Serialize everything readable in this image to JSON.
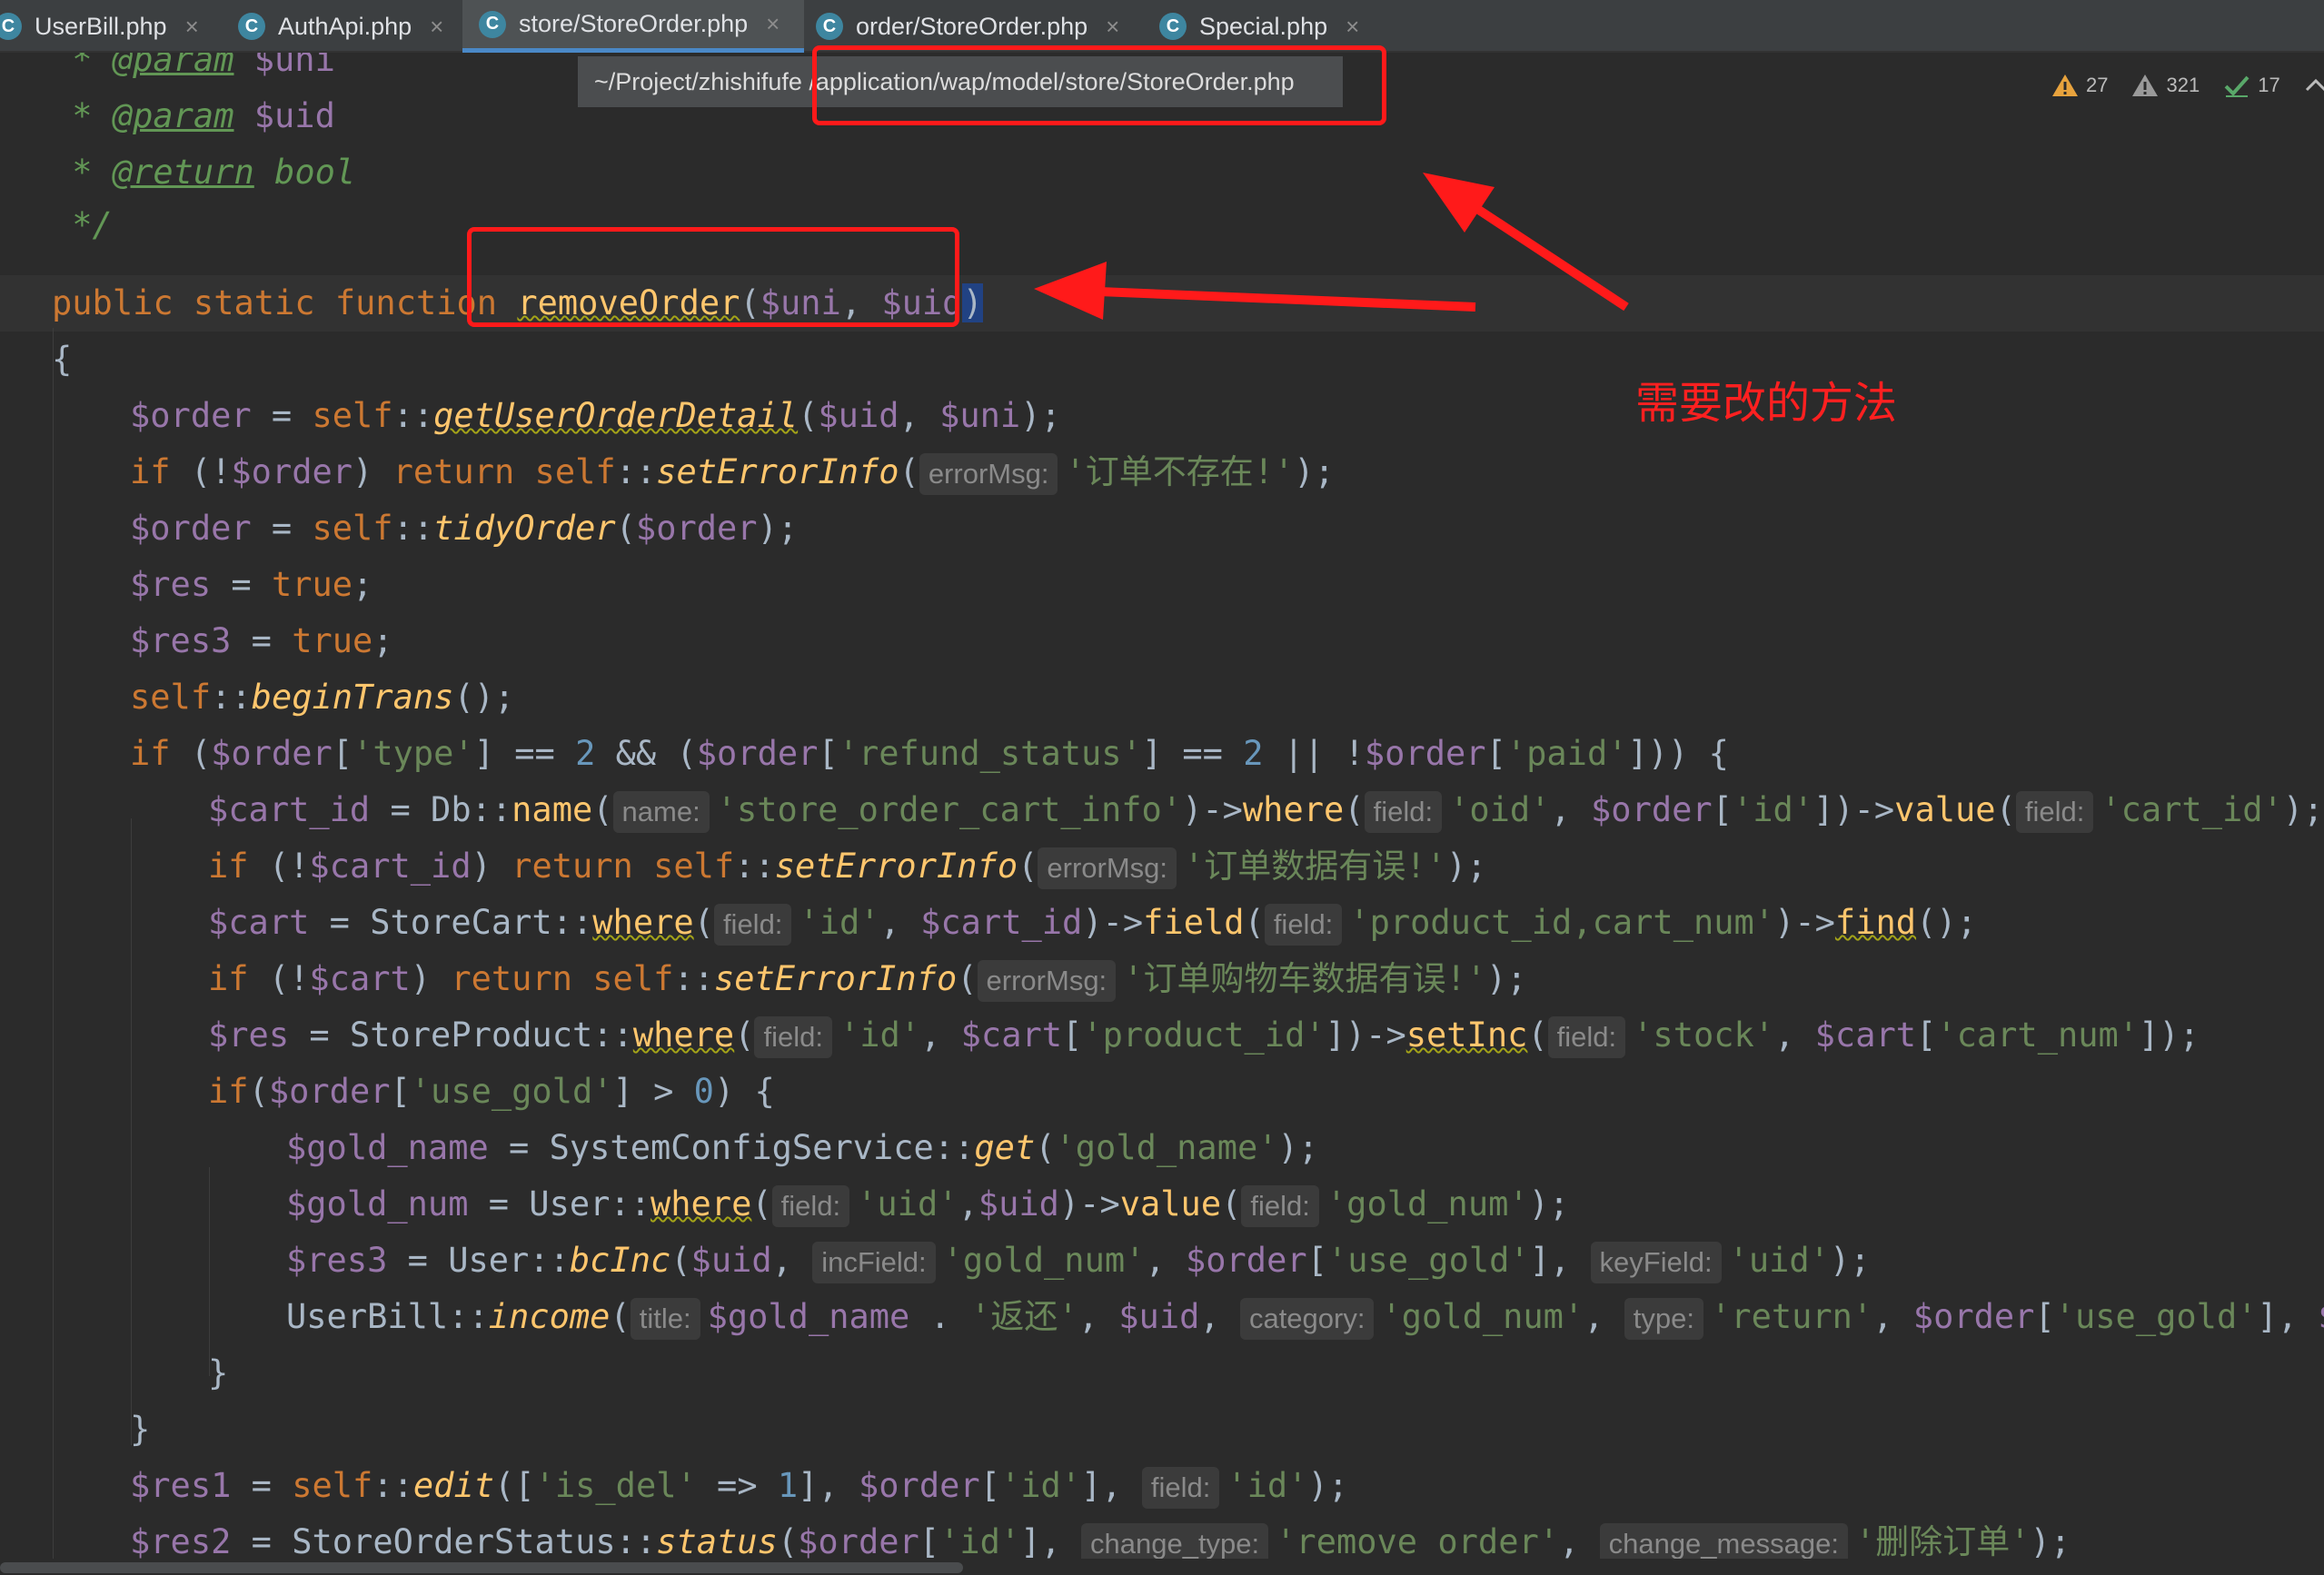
{
  "tabs": [
    {
      "label": "UserBill.php",
      "icon": "class-icon",
      "active": false
    },
    {
      "label": "AuthApi.php",
      "icon": "class-icon",
      "active": false
    },
    {
      "label": "store/StoreOrder.php",
      "icon": "class-icon",
      "active": true
    },
    {
      "label": "order/StoreOrder.php",
      "icon": "class-icon",
      "active": false
    },
    {
      "label": "Special.php",
      "icon": "class-icon",
      "active": false
    }
  ],
  "tab_icon_letter": "C",
  "tab_close_glyph": "×",
  "path_tooltip": "~/Project/zhishifufe /application/wap/model/store/StoreOrder.php",
  "inspections": {
    "warnings": "27",
    "weak_warnings": "321",
    "typos": "17"
  },
  "annotation_note": "需要改的方法",
  "colors": {
    "annotation": "#ff1a1a",
    "keyword": "#cc7832",
    "variable": "#9876aa",
    "string": "#6a8759",
    "number": "#6897bb",
    "function": "#ffc66d",
    "doc_comment": "#629755"
  },
  "code": {
    "l0": [
      [
        "com",
        " * "
      ],
      [
        "tag",
        "@param"
      ],
      [
        "var",
        " $uni"
      ]
    ],
    "l1": [
      [
        "com",
        " * "
      ],
      [
        "tag",
        "@param"
      ],
      [
        "var",
        " $uid"
      ]
    ],
    "l2": [
      [
        "com",
        " * "
      ],
      [
        "tag",
        "@return"
      ],
      [
        "com",
        " bool"
      ]
    ],
    "l3": [
      [
        "com",
        " */"
      ]
    ],
    "l4": [
      [
        "kw",
        "public static function "
      ],
      [
        "fnw",
        "removeOrder"
      ],
      [
        "p",
        "("
      ],
      [
        "var",
        "$uni"
      ],
      [
        "p",
        ", "
      ],
      [
        "var",
        "$uid"
      ],
      [
        "sel",
        ")"
      ]
    ],
    "l5": [
      [
        "p",
        "{"
      ]
    ],
    "l6": [
      [
        "var",
        "$order"
      ],
      [
        "p",
        " = "
      ],
      [
        "kw",
        "self"
      ],
      [
        "p",
        "::"
      ],
      [
        "fiw",
        "getUserOrderDetail"
      ],
      [
        "p",
        "("
      ],
      [
        "var",
        "$uid"
      ],
      [
        "p",
        ", "
      ],
      [
        "var",
        "$uni"
      ],
      [
        "p",
        ");"
      ]
    ],
    "l7": [
      [
        "kw",
        "if "
      ],
      [
        "p",
        "(!"
      ],
      [
        "var",
        "$order"
      ],
      [
        "p",
        ") "
      ],
      [
        "kw",
        "return self"
      ],
      [
        "p",
        "::"
      ],
      [
        "fi",
        "setErrorInfo"
      ],
      [
        "p",
        "("
      ],
      [
        "hint",
        "errorMsg:"
      ],
      [
        "str",
        "'订单不存在!'"
      ],
      [
        "p",
        ");"
      ]
    ],
    "l8": [
      [
        "var",
        "$order"
      ],
      [
        "p",
        " = "
      ],
      [
        "kw",
        "self"
      ],
      [
        "p",
        "::"
      ],
      [
        "fi",
        "tidyOrder"
      ],
      [
        "p",
        "("
      ],
      [
        "var",
        "$order"
      ],
      [
        "p",
        ");"
      ]
    ],
    "l9": [
      [
        "var",
        "$res"
      ],
      [
        "p",
        " = "
      ],
      [
        "kw",
        "true"
      ],
      [
        "p",
        ";"
      ]
    ],
    "l10": [
      [
        "var",
        "$res3"
      ],
      [
        "p",
        " = "
      ],
      [
        "kw",
        "true"
      ],
      [
        "p",
        ";"
      ]
    ],
    "l11": [
      [
        "kw",
        "self"
      ],
      [
        "p",
        "::"
      ],
      [
        "fi",
        "beginTrans"
      ],
      [
        "p",
        "();"
      ]
    ],
    "l12": [
      [
        "kw",
        "if "
      ],
      [
        "p",
        "("
      ],
      [
        "var",
        "$order"
      ],
      [
        "p",
        "["
      ],
      [
        "str",
        "'type'"
      ],
      [
        "p",
        "] == "
      ],
      [
        "num",
        "2"
      ],
      [
        "p",
        " && ("
      ],
      [
        "var",
        "$order"
      ],
      [
        "p",
        "["
      ],
      [
        "str",
        "'refund_status'"
      ],
      [
        "p",
        "] == "
      ],
      [
        "num",
        "2"
      ],
      [
        "p",
        " || !"
      ],
      [
        "var",
        "$order"
      ],
      [
        "p",
        "["
      ],
      [
        "str",
        "'paid'"
      ],
      [
        "p",
        "])) {"
      ]
    ],
    "l13": [
      [
        "var",
        "$cart_id"
      ],
      [
        "p",
        " = Db::"
      ],
      [
        "fn",
        "name"
      ],
      [
        "p",
        "("
      ],
      [
        "hint",
        "name:"
      ],
      [
        "str",
        "'store_order_cart_info'"
      ],
      [
        "p",
        ")->"
      ],
      [
        "fn",
        "where"
      ],
      [
        "p",
        "("
      ],
      [
        "hint",
        "field:"
      ],
      [
        "str",
        "'oid'"
      ],
      [
        "p",
        ", "
      ],
      [
        "var",
        "$order"
      ],
      [
        "p",
        "["
      ],
      [
        "str",
        "'id'"
      ],
      [
        "p",
        "])->"
      ],
      [
        "fn",
        "value"
      ],
      [
        "p",
        "("
      ],
      [
        "hint",
        "field:"
      ],
      [
        "str",
        "'cart_id'"
      ],
      [
        "p",
        ");"
      ]
    ],
    "l14": [
      [
        "kw",
        "if "
      ],
      [
        "p",
        "(!"
      ],
      [
        "var",
        "$cart_id"
      ],
      [
        "p",
        ") "
      ],
      [
        "kw",
        "return self"
      ],
      [
        "p",
        "::"
      ],
      [
        "fi",
        "setErrorInfo"
      ],
      [
        "p",
        "("
      ],
      [
        "hint",
        "errorMsg:"
      ],
      [
        "str",
        "'订单数据有误!'"
      ],
      [
        "p",
        ");"
      ]
    ],
    "l15": [
      [
        "var",
        "$cart"
      ],
      [
        "p",
        " = StoreCart::"
      ],
      [
        "fnw",
        "where"
      ],
      [
        "p",
        "("
      ],
      [
        "hint",
        "field:"
      ],
      [
        "str",
        "'id'"
      ],
      [
        "p",
        ", "
      ],
      [
        "var",
        "$cart_id"
      ],
      [
        "p",
        ")->"
      ],
      [
        "fn",
        "field"
      ],
      [
        "p",
        "("
      ],
      [
        "hint",
        "field:"
      ],
      [
        "str",
        "'product_id,cart_num'"
      ],
      [
        "p",
        ")->"
      ],
      [
        "fnw",
        "find"
      ],
      [
        "p",
        "();"
      ]
    ],
    "l16": [
      [
        "kw",
        "if "
      ],
      [
        "p",
        "(!"
      ],
      [
        "var",
        "$cart"
      ],
      [
        "p",
        ") "
      ],
      [
        "kw",
        "return self"
      ],
      [
        "p",
        "::"
      ],
      [
        "fi",
        "setErrorInfo"
      ],
      [
        "p",
        "("
      ],
      [
        "hint",
        "errorMsg:"
      ],
      [
        "str",
        "'订单购物车数据有误!'"
      ],
      [
        "p",
        ");"
      ]
    ],
    "l17": [
      [
        "var",
        "$res"
      ],
      [
        "p",
        " = StoreProduct::"
      ],
      [
        "fnw",
        "where"
      ],
      [
        "p",
        "("
      ],
      [
        "hint",
        "field:"
      ],
      [
        "str",
        "'id'"
      ],
      [
        "p",
        ", "
      ],
      [
        "var",
        "$cart"
      ],
      [
        "p",
        "["
      ],
      [
        "str",
        "'product_id'"
      ],
      [
        "p",
        "])->"
      ],
      [
        "fnw",
        "setInc"
      ],
      [
        "p",
        "("
      ],
      [
        "hint",
        "field:"
      ],
      [
        "str",
        "'stock'"
      ],
      [
        "p",
        ", "
      ],
      [
        "var",
        "$cart"
      ],
      [
        "p",
        "["
      ],
      [
        "str",
        "'cart_num'"
      ],
      [
        "p",
        "]);"
      ]
    ],
    "l18": [
      [
        "kw",
        "if"
      ],
      [
        "p",
        "("
      ],
      [
        "var",
        "$order"
      ],
      [
        "p",
        "["
      ],
      [
        "str",
        "'use_gold'"
      ],
      [
        "p",
        "] > "
      ],
      [
        "num",
        "0"
      ],
      [
        "p",
        ") {"
      ]
    ],
    "l19": [
      [
        "var",
        "$gold_name"
      ],
      [
        "p",
        " = SystemConfigService::"
      ],
      [
        "fi",
        "get"
      ],
      [
        "p",
        "("
      ],
      [
        "str",
        "'gold_name'"
      ],
      [
        "p",
        ");"
      ]
    ],
    "l20": [
      [
        "var",
        "$gold_num"
      ],
      [
        "p",
        " = User::"
      ],
      [
        "fnw",
        "where"
      ],
      [
        "p",
        "("
      ],
      [
        "hint",
        "field:"
      ],
      [
        "str",
        "'uid'"
      ],
      [
        "p",
        ","
      ],
      [
        "var",
        "$uid"
      ],
      [
        "p",
        ")->"
      ],
      [
        "fn",
        "value"
      ],
      [
        "p",
        "("
      ],
      [
        "hint",
        "field:"
      ],
      [
        "str",
        "'gold_num'"
      ],
      [
        "p",
        ");"
      ]
    ],
    "l21": [
      [
        "var",
        "$res3"
      ],
      [
        "p",
        " = User::"
      ],
      [
        "fi",
        "bcInc"
      ],
      [
        "p",
        "("
      ],
      [
        "var",
        "$uid"
      ],
      [
        "p",
        ", "
      ],
      [
        "hint",
        "incField:"
      ],
      [
        "str",
        "'gold_num'"
      ],
      [
        "p",
        ", "
      ],
      [
        "var",
        "$order"
      ],
      [
        "p",
        "["
      ],
      [
        "str",
        "'use_gold'"
      ],
      [
        "p",
        "], "
      ],
      [
        "hint",
        "keyField:"
      ],
      [
        "str",
        "'uid'"
      ],
      [
        "p",
        ");"
      ]
    ],
    "l22": [
      [
        "p",
        "UserBill::"
      ],
      [
        "fi",
        "income"
      ],
      [
        "p",
        "("
      ],
      [
        "hint",
        "title:"
      ],
      [
        "var",
        "$gold_name"
      ],
      [
        "p",
        " . "
      ],
      [
        "str",
        "'返还'"
      ],
      [
        "p",
        ", "
      ],
      [
        "var",
        "$uid"
      ],
      [
        "p",
        ", "
      ],
      [
        "hint",
        "category:"
      ],
      [
        "str",
        "'gold_num'"
      ],
      [
        "p",
        ", "
      ],
      [
        "hint",
        "type:"
      ],
      [
        "str",
        "'return'"
      ],
      [
        "p",
        ", "
      ],
      [
        "var",
        "$order"
      ],
      [
        "p",
        "["
      ],
      [
        "str",
        "'use_gold'"
      ],
      [
        "p",
        "], "
      ],
      [
        "var",
        "$o"
      ]
    ],
    "l23": [
      [
        "p",
        "}"
      ]
    ],
    "l24": [
      [
        "p",
        "}"
      ]
    ],
    "l25": [
      [
        "var",
        "$res1"
      ],
      [
        "p",
        " = "
      ],
      [
        "kw",
        "self"
      ],
      [
        "p",
        "::"
      ],
      [
        "fi",
        "edit"
      ],
      [
        "p",
        "(["
      ],
      [
        "str",
        "'is_del'"
      ],
      [
        "p",
        " => "
      ],
      [
        "num",
        "1"
      ],
      [
        "p",
        "], "
      ],
      [
        "var",
        "$order"
      ],
      [
        "p",
        "["
      ],
      [
        "str",
        "'id'"
      ],
      [
        "p",
        "], "
      ],
      [
        "hint",
        "field:"
      ],
      [
        "str",
        "'id'"
      ],
      [
        "p",
        ");"
      ]
    ],
    "l26": [
      [
        "var",
        "$res2"
      ],
      [
        "p",
        " = StoreOrderStatus::"
      ],
      [
        "fi",
        "status"
      ],
      [
        "p",
        "("
      ],
      [
        "var",
        "$order"
      ],
      [
        "p",
        "["
      ],
      [
        "str",
        "'id'"
      ],
      [
        "p",
        "], "
      ],
      [
        "hint",
        "change_type:"
      ],
      [
        "str",
        "'remove_order'"
      ],
      [
        "p",
        ", "
      ],
      [
        "hint",
        "change_message:"
      ],
      [
        "str",
        "'删除订单'"
      ],
      [
        "p",
        ");"
      ]
    ]
  }
}
